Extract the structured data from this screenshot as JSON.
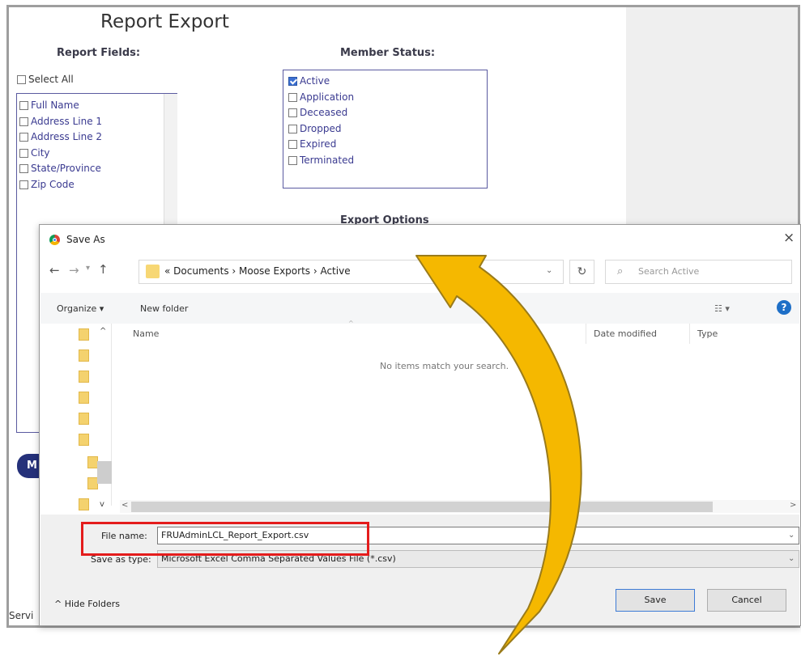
{
  "page": {
    "title": "Report Export",
    "report_fields_heading": "Report Fields:",
    "member_status_heading": "Member Status:",
    "export_options_heading": "Export Options",
    "select_all_label": "Select All",
    "report_fields": [
      "Full Name",
      "Address Line 1",
      "Address Line 2",
      "City",
      "State/Province",
      "Zip Code"
    ],
    "member_statuses": [
      {
        "label": "Active",
        "checked": true
      },
      {
        "label": "Application",
        "checked": false
      },
      {
        "label": "Deceased",
        "checked": false
      },
      {
        "label": "Dropped",
        "checked": false
      },
      {
        "label": "Expired",
        "checked": false
      },
      {
        "label": "Terminated",
        "checked": false
      }
    ],
    "blue_button_label": "M",
    "footer_text": "Servi"
  },
  "dialog": {
    "title": "Save As",
    "close_glyph": "×",
    "address_path": "« Documents › Moose Exports › Active",
    "search_placeholder": "Search Active",
    "toolbar": {
      "organize": "Organize ▾",
      "new_folder": "New folder"
    },
    "columns": {
      "name": "Name",
      "date_modified": "Date modified",
      "type": "Type"
    },
    "empty_message": "No items match your search.",
    "file_name_label": "File name:",
    "file_name_value": "FRUAdminLCL_Report_Export.csv",
    "save_as_type_label": "Save as type:",
    "save_as_type_value": "Microsoft Excel Comma Separated Values File (*.csv)",
    "hide_folders": "Hide Folders",
    "save_label": "Save",
    "cancel_label": "Cancel"
  },
  "colors": {
    "highlight": "#e41c1c",
    "arrow_fill": "#f5b800",
    "arrow_stroke": "#9a7b1a",
    "link_text": "#3a3a90"
  }
}
